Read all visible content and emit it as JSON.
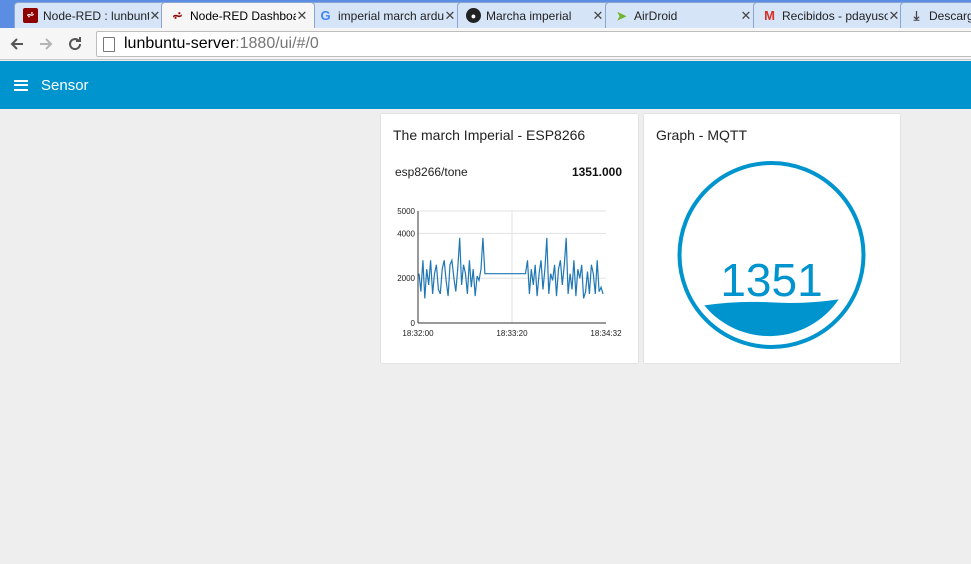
{
  "browser": {
    "tabs": [
      {
        "title": "Node-RED : lunbuntu",
        "icon": "node-red-icon",
        "active": false
      },
      {
        "title": "Node-RED Dashboard",
        "icon": "node-red-dashboard-icon",
        "active": true
      },
      {
        "title": "imperial march arduino",
        "icon": "google-icon",
        "active": false
      },
      {
        "title": "Marcha imperial",
        "icon": "github-icon",
        "active": false
      },
      {
        "title": "AirDroid",
        "icon": "airdroid-icon",
        "active": false
      },
      {
        "title": "Recibidos - pdayuso",
        "icon": "gmail-icon",
        "active": false
      },
      {
        "title": "Descargas",
        "icon": "download-icon",
        "active": false
      }
    ],
    "close_glyph": "✕",
    "address": {
      "host": "lunbuntu-server",
      "path": ":1880/ui/#/0"
    }
  },
  "appbar": {
    "title": "Sensor",
    "color": "#0094ce"
  },
  "chart_card": {
    "title": "The march Imperial - ESP8266",
    "series_label": "esp8266/tone",
    "series_value": "1351.000"
  },
  "gauge_card": {
    "title": "Graph - MQTT",
    "value": "1351",
    "level": 0.2,
    "color": "#0094ce"
  },
  "chart_data": {
    "type": "line",
    "series": [
      {
        "name": "esp8266/tone",
        "color": "#1f77b4"
      }
    ],
    "x": [
      "18:32:00",
      "18:33:20",
      "18:34:32"
    ],
    "y_ticks": [
      0,
      2000,
      4000,
      5000
    ],
    "ylim": [
      0,
      5000
    ],
    "grid": true,
    "values": [
      2200,
      1400,
      2800,
      1100,
      2400,
      1700,
      2800,
      1300,
      2200,
      2600,
      1500,
      1300,
      2400,
      2800,
      1900,
      1200,
      2600,
      2800,
      2000,
      1400,
      2400,
      3800,
      1700,
      2600,
      2200,
      1300,
      2800,
      1600,
      2400,
      1200,
      2100,
      1900,
      2400,
      3800,
      2200,
      2200,
      2200,
      2200,
      2200,
      2200,
      2200,
      2200,
      2200,
      2200,
      2200,
      2200,
      2200,
      2200,
      2200,
      2200,
      2200,
      2200,
      2200,
      2200,
      2200,
      2200,
      2800,
      1300,
      2400,
      1700,
      2600,
      1200,
      2200,
      2800,
      1500,
      2400,
      3800,
      1300,
      2200,
      1900,
      2600,
      1200,
      2400,
      2800,
      1700,
      2600,
      3800,
      1300,
      2200,
      1500,
      2800,
      1200,
      2400,
      2000,
      2600,
      1100,
      1400,
      2300,
      1300,
      2600,
      2200,
      1300,
      2800,
      1400,
      1600,
      1300
    ]
  }
}
